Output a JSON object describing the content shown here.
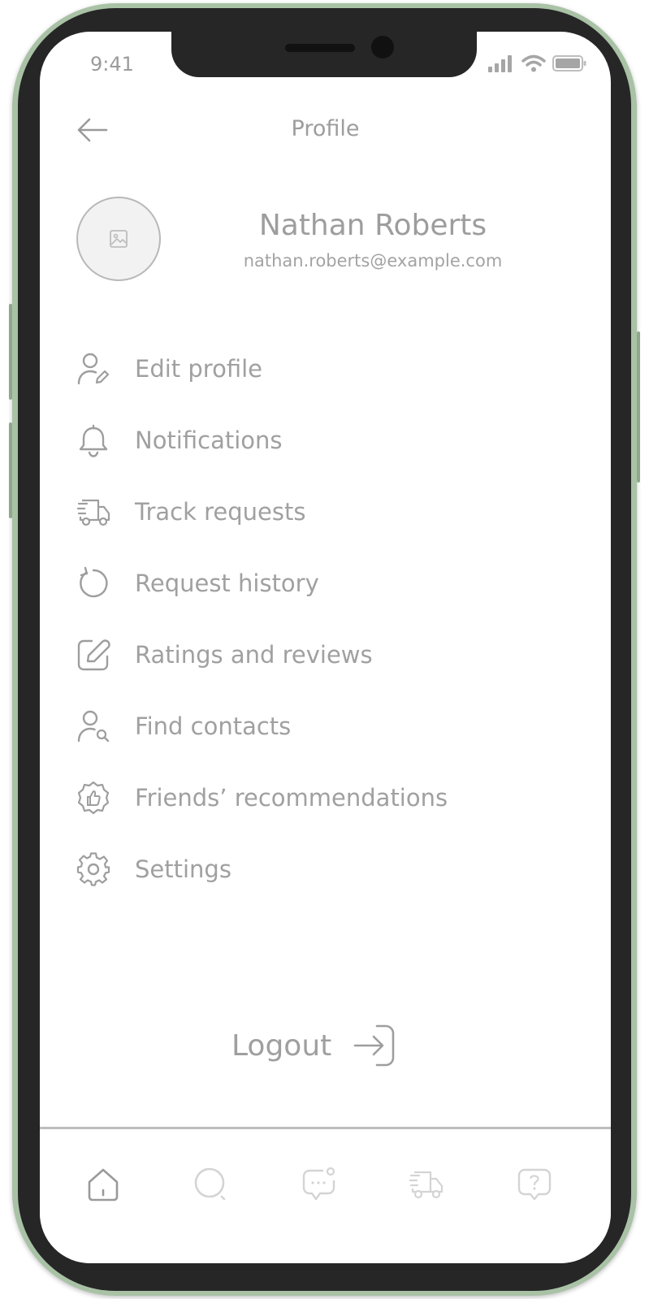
{
  "status_bar": {
    "time": "9:41"
  },
  "header": {
    "title": "Profile",
    "back_icon": "arrow-left-icon"
  },
  "profile": {
    "name": "Nathan Roberts",
    "email": "nathan.roberts@example.com",
    "avatar_icon": "image-placeholder-icon"
  },
  "menu": {
    "items": [
      {
        "label": "Edit profile",
        "icon": "user-edit-icon"
      },
      {
        "label": "Notifications",
        "icon": "bell-icon"
      },
      {
        "label": "Track requests",
        "icon": "truck-icon"
      },
      {
        "label": "Request history",
        "icon": "history-icon"
      },
      {
        "label": "Ratings and reviews",
        "icon": "edit-square-icon"
      },
      {
        "label": "Find contacts",
        "icon": "user-search-icon"
      },
      {
        "label": "Friends’ recommendations",
        "icon": "thumbs-up-badge-icon"
      },
      {
        "label": "Settings",
        "icon": "gear-icon"
      }
    ]
  },
  "logout": {
    "label": "Logout",
    "icon": "login-arrow-icon"
  },
  "tab_bar": {
    "tabs": [
      {
        "name": "home",
        "icon": "home-icon"
      },
      {
        "name": "search",
        "icon": "search-icon"
      },
      {
        "name": "messages",
        "icon": "chat-icon"
      },
      {
        "name": "delivery",
        "icon": "truck-icon"
      },
      {
        "name": "help",
        "icon": "help-icon"
      }
    ]
  },
  "colors": {
    "text": "#9d9d9d",
    "frame": "#a9c2a6",
    "bezel": "#262626"
  }
}
